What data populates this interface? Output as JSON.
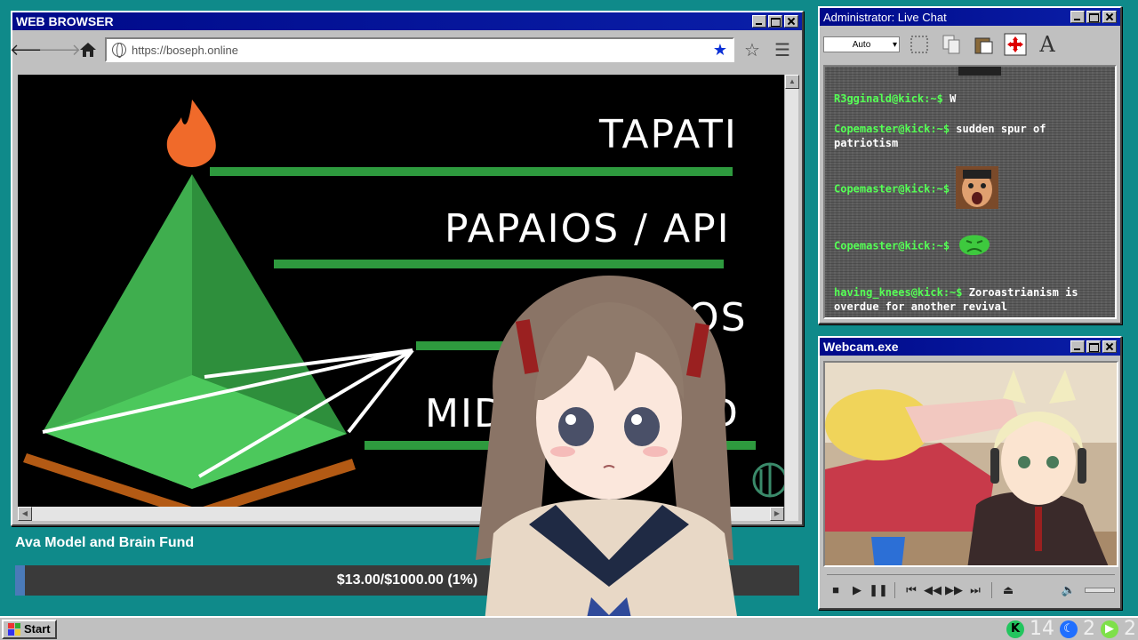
{
  "browser": {
    "title": "WEB BROWSER",
    "url": "https://boseph.online",
    "slide": {
      "line1": "TAPATI",
      "line2": "PAPAIOS / API",
      "line3": "OS",
      "line4": "MID",
      "line4b": "D"
    }
  },
  "fund": {
    "title": "Ava Model and Brain Fund",
    "progress_text": "$13.00/$1000.00 (1%)",
    "progress_fraction": 0.013
  },
  "chat": {
    "title": "Administrator: Live Chat",
    "mode": "Auto",
    "messages": [
      {
        "user": "R3gginald@kick:~$",
        "text": "W"
      },
      {
        "user": "Copemaster@kick:~$",
        "text": "sudden spur of patriotism"
      },
      {
        "user": "Copemaster@kick:~$",
        "text": "",
        "emote": "shocked-face-emote"
      },
      {
        "user": "Copemaster@kick:~$",
        "text": "",
        "emote": "green-sick-face-emote"
      },
      {
        "user": "having_knees@kick:~$",
        "text": "Zoroastrianism is overdue for another revival"
      }
    ]
  },
  "webcam": {
    "title": "Webcam.exe"
  },
  "taskbar": {
    "start_label": "Start",
    "tray": [
      {
        "icon": "kick-icon",
        "value": "14",
        "color": "#22c55e"
      },
      {
        "icon": "moon-icon",
        "value": "2",
        "color": "#1f6fff"
      },
      {
        "icon": "play-icon",
        "value": "2",
        "color": "#7ee04a"
      }
    ]
  },
  "colors": {
    "title_bar": "#000a8a",
    "desktop": "#0f8a8a",
    "chat_user": "#55ff55"
  }
}
